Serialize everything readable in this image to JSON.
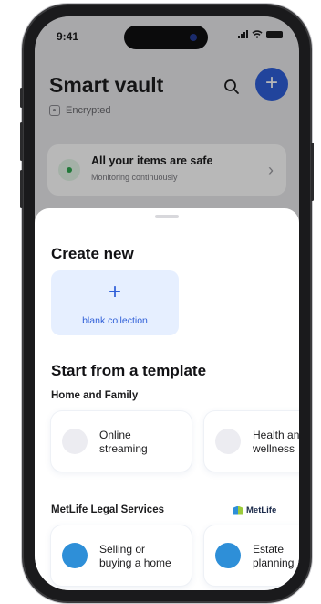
{
  "status_bar": {
    "time": "9:41"
  },
  "header": {
    "title": "Smart vault",
    "encrypted_label": "Encrypted"
  },
  "status_card": {
    "title": "All your items are safe",
    "subtitle": "Monitoring continuously"
  },
  "sheet": {
    "create_title": "Create new",
    "blank_label": "blank collection",
    "template_title": "Start from a template",
    "sections": [
      {
        "label": "Home and Family",
        "cards": [
          {
            "label": "Online\nstreaming",
            "circle_color": "#ececf1"
          },
          {
            "label": "Health and\nwellness",
            "circle_color": "#ececf1"
          }
        ]
      },
      {
        "label": "MetLife Legal Services",
        "brand": "MetLife",
        "cards": [
          {
            "label": "Selling or\nbuying a home",
            "circle_color": "#2e8fd8"
          },
          {
            "label": "Estate\nplanning",
            "circle_color": "#2e8fd8"
          }
        ]
      }
    ]
  },
  "colors": {
    "accent": "#2f5fd8",
    "blank_card_bg": "#e6efff",
    "safe_green": "#2fa84f",
    "metlife_blue": "#2e8fd8",
    "metlife_green": "#9ccb3b"
  },
  "icons": {
    "search": "search-icon",
    "add": "plus-icon",
    "lock": "lock-icon",
    "chevron": "chevron-right-icon"
  }
}
